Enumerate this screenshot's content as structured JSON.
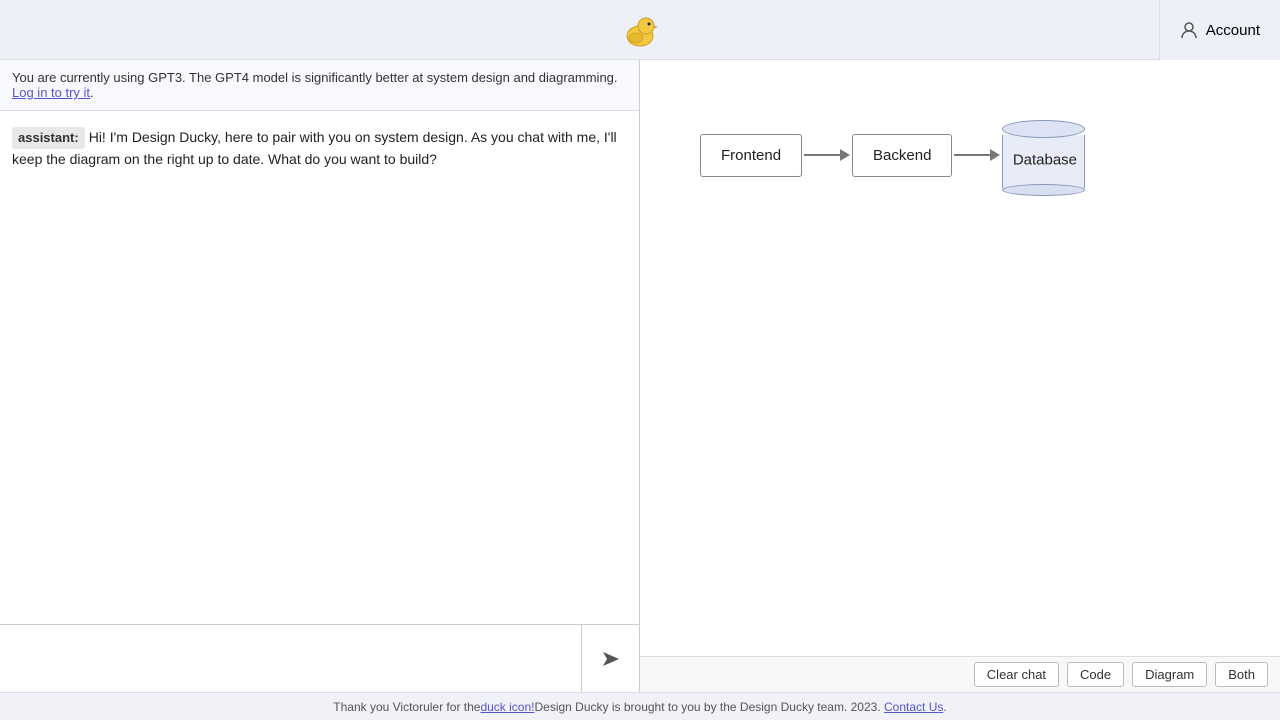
{
  "header": {
    "logo_alt": "Design Ducky logo",
    "account_label": "Account"
  },
  "banner": {
    "text": "You are currently using GPT3. The GPT4 model is significantly better at system design and diagramming.",
    "link_text": "Log in to try it",
    "link_suffix": "."
  },
  "chat": {
    "messages": [
      {
        "role": "assistant",
        "label": "assistant:",
        "text": "Hi! I'm Design Ducky, here to pair with you on system design. As you chat with me, I'll keep the diagram on the right up to date. What do you want to build?"
      }
    ],
    "input_placeholder": ""
  },
  "diagram": {
    "nodes": [
      {
        "id": "frontend",
        "label": "Frontend",
        "type": "rect"
      },
      {
        "id": "backend",
        "label": "Backend",
        "type": "rect"
      },
      {
        "id": "database",
        "label": "Database",
        "type": "cylinder"
      }
    ],
    "edges": [
      {
        "from": "frontend",
        "to": "backend"
      },
      {
        "from": "backend",
        "to": "database"
      }
    ]
  },
  "toolbar": {
    "clear_chat_label": "Clear chat",
    "code_label": "Code",
    "diagram_label": "Diagram",
    "both_label": "Both"
  },
  "footer": {
    "text_before_link": "Thank you Victoruler for the ",
    "duck_link_text": "duck icon!",
    "text_after_link": " Design Ducky is brought to you by the Design Ducky team. 2023.",
    "contact_link": "Contact Us",
    "period": "."
  }
}
